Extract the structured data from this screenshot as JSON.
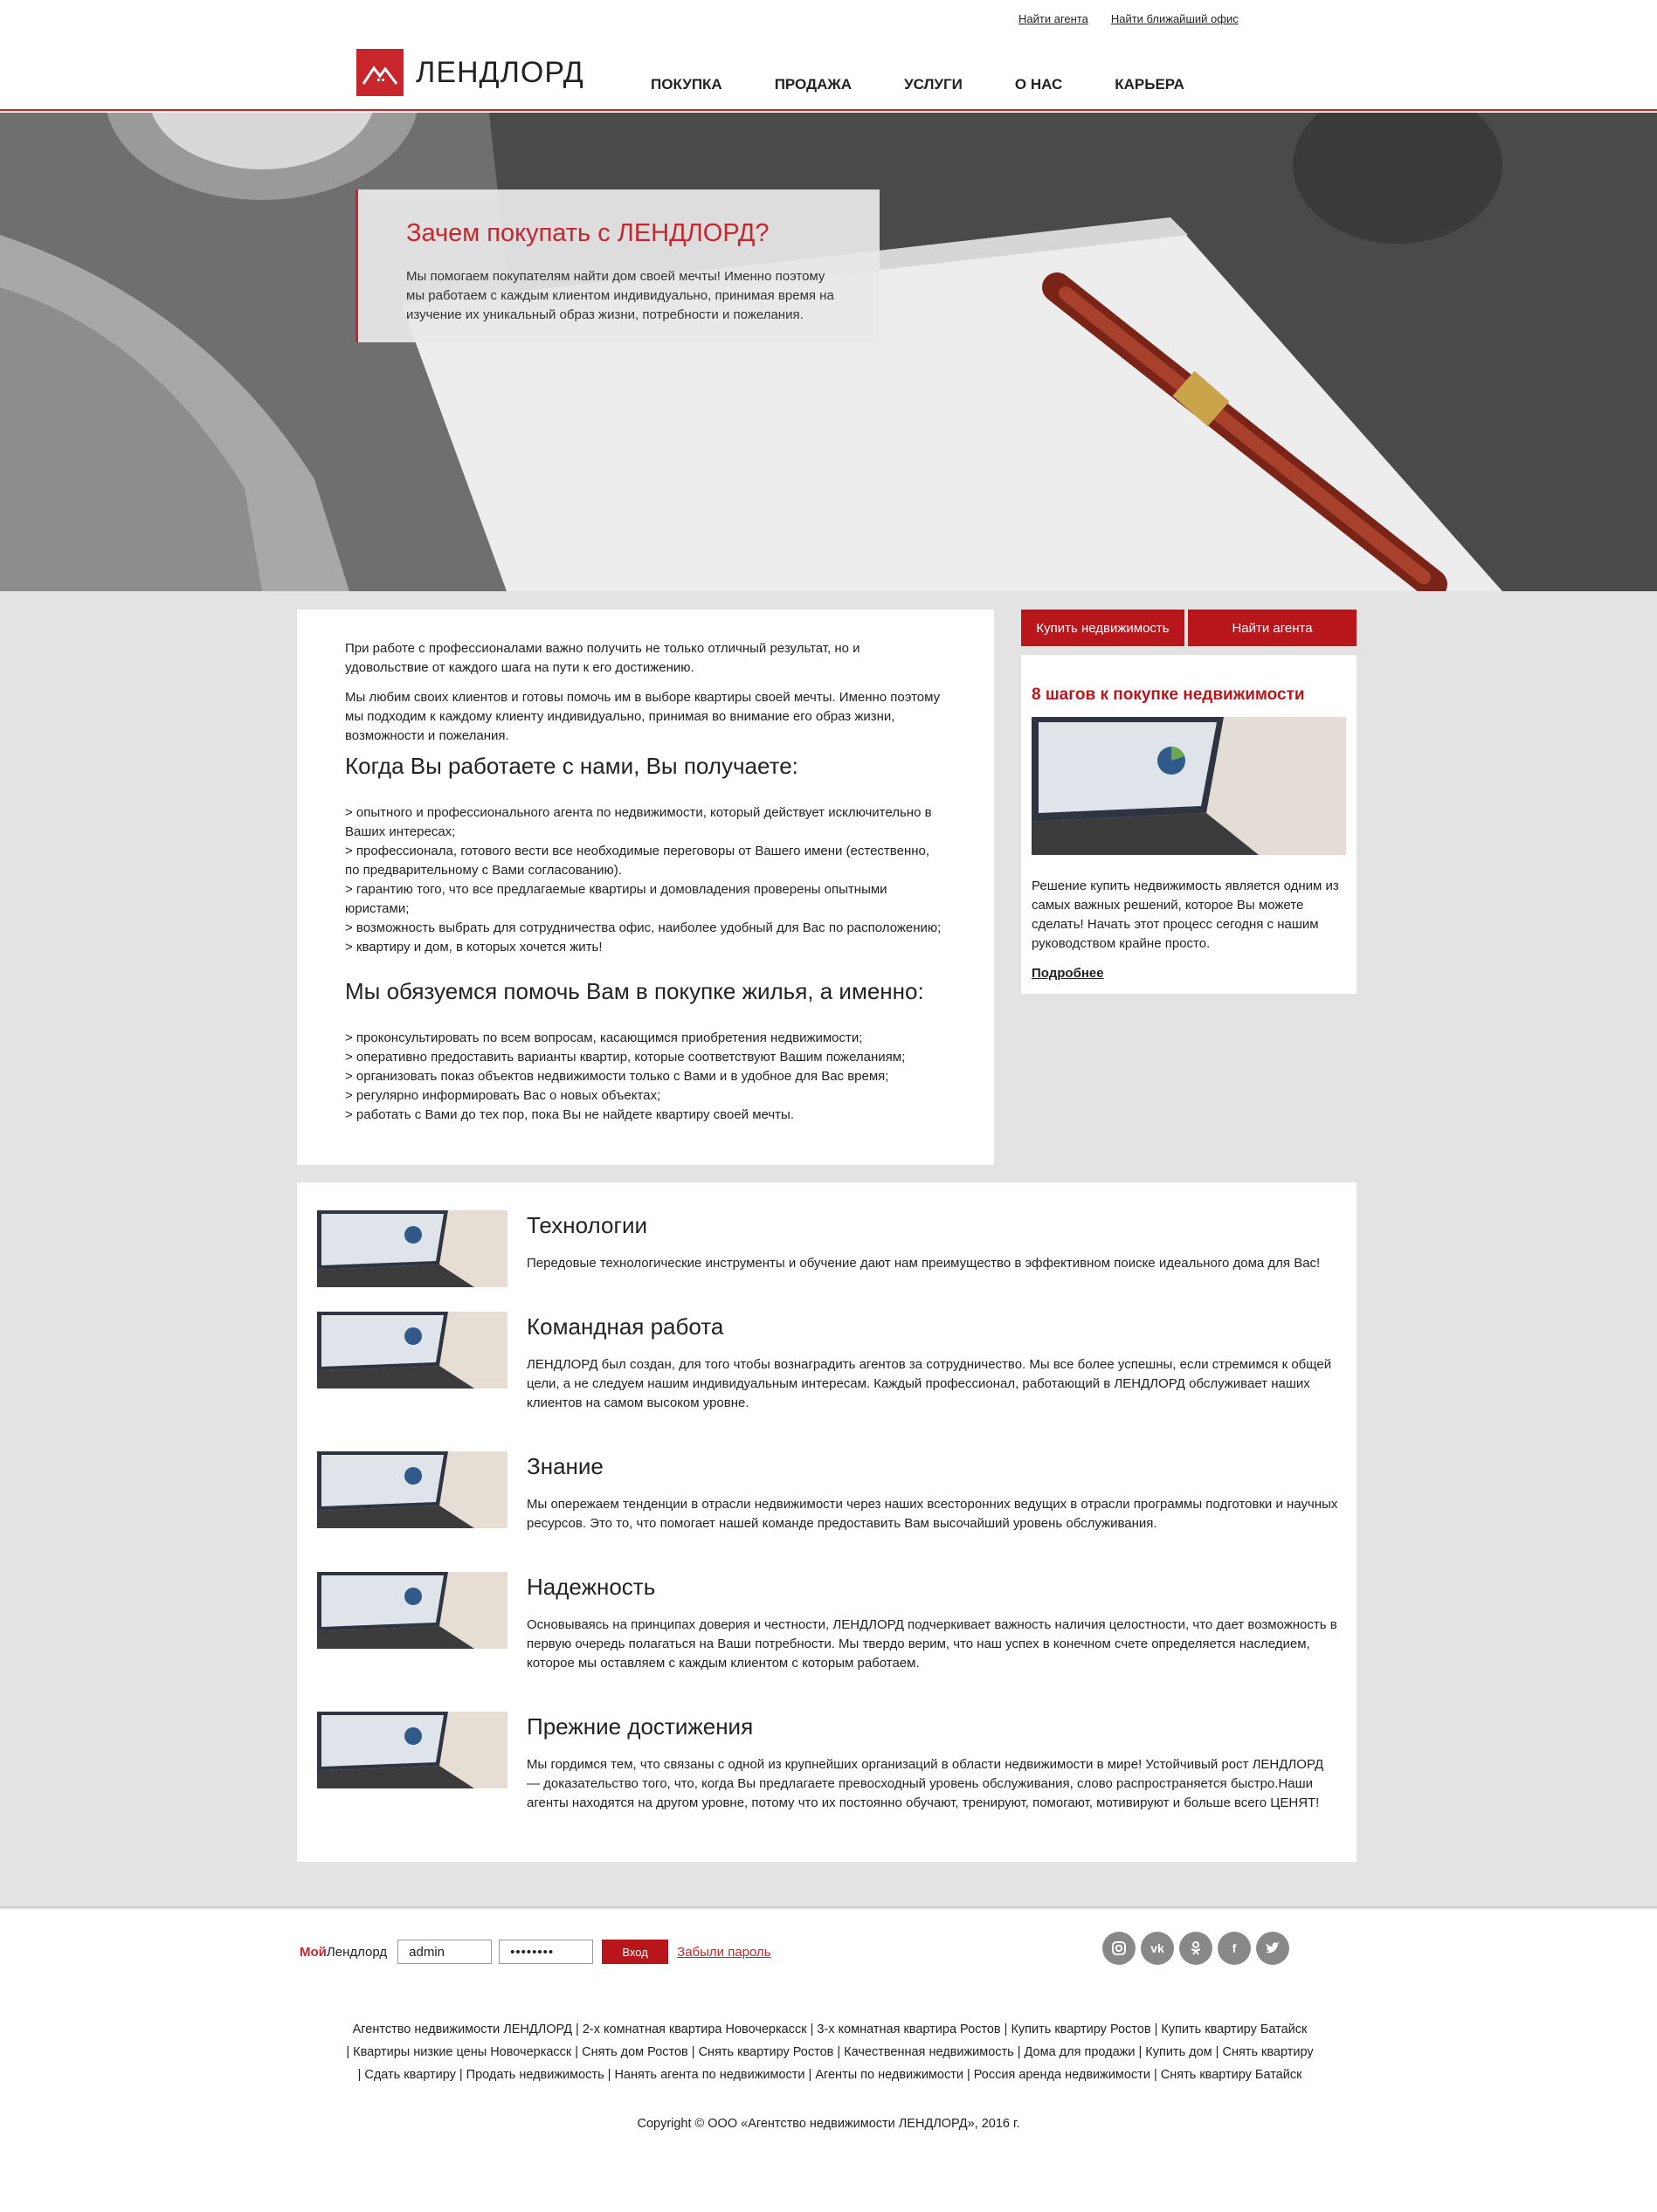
{
  "header": {
    "top_links": [
      "Найти агента",
      "Найти ближайший офис"
    ],
    "logo_text": "ЛЕНДЛОРД",
    "nav": [
      "ПОКУПКА",
      "ПРОДАЖА",
      "УСЛУГИ",
      "О НАС",
      "КАРЬЕРА"
    ]
  },
  "hero": {
    "title": "Зачем покупать с ЛЕНДЛОРД?",
    "text": "Мы помогаем покупателям найти дом своей мечты! Именно поэтому мы работаем с каждым клиентом индивидуально, принимая время на изучение их уникальный образ жизни, потребности и пожелания."
  },
  "main": {
    "intro1": "При работе с профессионалами важно получить не только отличный результат, но и удовольствие от каждого шага на пути к его достижению.",
    "intro2": "Мы любим своих клиентов и готовы помочь им в выборе квартиры своей мечты. Именно поэтому мы подходим к каждому клиенту индивидуально, принимая во внимание его образ жизни, возможности и пожелания.",
    "heading1": "Когда Вы работаете с нами, Вы получаете:",
    "list1": [
      "> опытного и профессионального агента по недвижимости, который действует исключительно в Ваших интересах;",
      "> профессионала, готового вести все необходимые переговоры от Вашего имени (естественно, по предварительному с Вами согласованию).",
      "> гарантию того, что все предлагаемые квартиры и домовладения проверены опытными юристами;",
      "> возможность выбрать для сотрудничества офис, наиболее удобный для Вас по расположению;",
      "> квартиру и дом, в которых хочется жить!"
    ],
    "heading2": "Мы обязуемся помочь Вам в покупке жилья, а именно:",
    "list2": [
      "> проконсультировать по всем вопросам, касающимся приобретения недвижимости;",
      "> оперативно предоставить варианты квартир, которые соответствуют Вашим пожеланиям;",
      "> организовать показ объектов недвижимости только с Вами и в удобное для Вас время;",
      "> регулярно информировать Вас о новых объектах;",
      "> работать с Вами до тех пор, пока Вы не найдете квартиру своей мечты."
    ]
  },
  "sidebar": {
    "btn_buy": "Купить недвижимость",
    "btn_agent": "Найти агента",
    "title": "8 шагов к покупке недвижимости",
    "text": "Решение купить недвижимость является одним из самых важных решений, которое Вы можете сделать! Начать этот процесс сегодня с нашим руководством крайне просто.",
    "more": "Подробнее"
  },
  "features": [
    {
      "title": "Технологии",
      "text": "Передовые технологические инструменты и обучение дают нам преимущество в эффективном поиске идеального дома для Вас!"
    },
    {
      "title": "Командная работа",
      "text": "ЛЕНДЛОРД был создан, для того чтобы вознаградить агентов за сотрудничество. Мы все более успешны, если стремимся к общей цели, а не следуем нашим индивидуальным интересам. Каждый профессионал, работающий в ЛЕНДЛОРД обслуживает наших клиентов на самом высоком уровне."
    },
    {
      "title": "Знание",
      "text": "Мы опережаем тенденции в отрасли недвижимости через наших всесторонних ведущих в отрасли программы подготовки и научных ресурсов. Это то, что помогает нашей команде предоставить Вам высочайший уровень обслуживания."
    },
    {
      "title": "Надежность",
      "text": "Основываясь на принципах доверия и честности, ЛЕНДЛОРД подчеркивает важность наличия целостности, что дает возможность в первую очередь полагаться на Ваши потребности. Мы твердо верим, что наш успех в конечном счете определяется наследием, которое мы оставляем с каждым клиентом с которым работаем."
    },
    {
      "title": "Прежние достижения",
      "text": "Мы гордимся тем, что связаны с одной из крупнейших организаций в области недвижимости в мире! Устойчивый рост ЛЕНДЛОРД — доказательство того, что, когда Вы предлагаете превосходный уровень обслуживания, слово распространяется быстро.Наши агенты находятся на другом уровне, потому что их постоянно обучают, тренируют, помогают, мотивируют и больше всего ЦЕНЯТ!"
    }
  ],
  "footer": {
    "brand_red": "Мой",
    "brand_rest": "Лендлорд",
    "login_value": "admin",
    "password_value": "••••••••",
    "login_btn": "Вход",
    "forgot": "Забыли пароль",
    "social_icons": [
      "instagram-icon",
      "vk-icon",
      "odnoklassniki-icon",
      "facebook-icon",
      "twitter-icon"
    ],
    "links_line1": "Агентство недвижимости ЛЕНДЛОРД | 2-х комнатная квартира Новочеркасск | 3-х комнатная квартира Ростов | Купить квартиру Ростов | Купить квартиру Батайск",
    "links_line2": "| Квартиры низкие цены Новочеркасск | Снять дом Ростов | Снять квартиру Ростов | Качественная недвижимость | Дома для продажи | Купить дом | Снять квартиру",
    "links_line3": "| Сдать квартиру | Продать недвижимость | Нанять агента по недвижимости | Агенты по недвижимости | Россия аренда недвижимости | Снять квартиру Батайск",
    "copyright": "Copyright © ООО «Агентство недвижимости ЛЕНДЛОРД», 2016 г."
  },
  "colors": {
    "accent": "#c8262c",
    "button": "#b8161b",
    "grey_bg": "#e3e3e3"
  }
}
